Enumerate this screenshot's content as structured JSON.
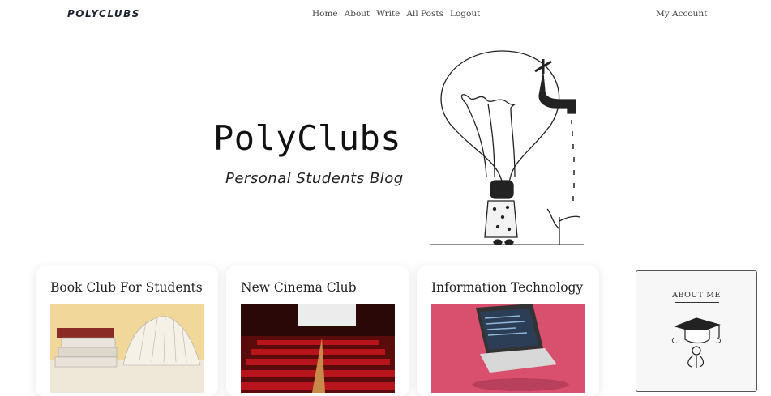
{
  "nav": {
    "logo": "POLYCLUBS",
    "links": [
      "Home",
      "About",
      "Write",
      "All Posts",
      "Logout"
    ],
    "account": "My Account"
  },
  "hero": {
    "title": "PolyClubs",
    "subtitle": "Personal Students Blog"
  },
  "cards": [
    {
      "title": "Book Club For Students"
    },
    {
      "title": "New Cinema Club"
    },
    {
      "title": "Information Technology"
    }
  ],
  "sidebar": {
    "about_title": "ABOUT ME"
  },
  "icons": {
    "hero": "lightbulb-faucet-illustration",
    "about": "graduation-cap-illustration"
  }
}
